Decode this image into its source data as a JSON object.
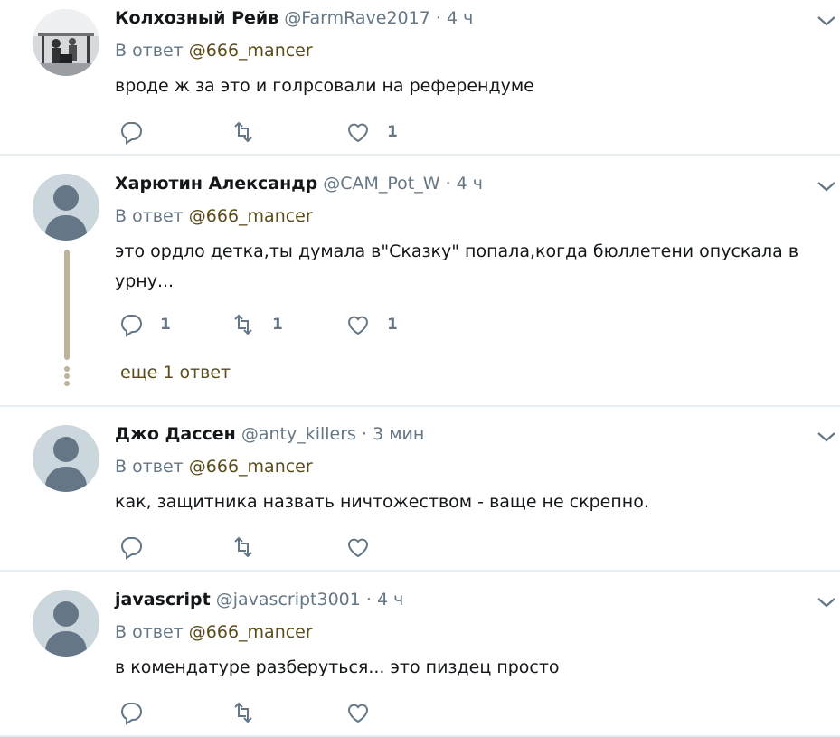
{
  "tweets": [
    {
      "name": "Колхозный Рейв",
      "handle": "@FarmRave2017",
      "time": "· 4 ч",
      "reply_prefix": "В ответ",
      "reply_to": "@666_mancer",
      "text": "вроде ж за это и голрсовали на референдуме",
      "reply_count": "",
      "retweet_count": "",
      "like_count": "1",
      "avatar": "photo"
    },
    {
      "name": "Харютин Александр",
      "handle": "@CAM_Pot_W",
      "time": "· 4 ч",
      "reply_prefix": "В ответ",
      "reply_to": "@666_mancer",
      "text": "это ордло детка,ты думала в\"Сказку\" попала,когда бюллетени опускала в урну...",
      "reply_count": "1",
      "retweet_count": "1",
      "like_count": "1",
      "avatar": "default",
      "more_replies": "еще 1 ответ"
    },
    {
      "name": "Джо Дассен",
      "handle": "@anty_killers",
      "time": "· 3 мин",
      "reply_prefix": "В ответ",
      "reply_to": "@666_mancer",
      "text": "как, защитника назвать ничтожеством - ваще не скрепно.",
      "reply_count": "",
      "retweet_count": "",
      "like_count": "",
      "avatar": "default"
    },
    {
      "name": "javascript",
      "handle": "@javascript3001",
      "time": "· 4 ч",
      "reply_prefix": "В ответ",
      "reply_to": "@666_mancer",
      "text": "в комендатуре разберуться... это пиздец просто",
      "reply_count": "",
      "retweet_count": "",
      "like_count": "",
      "avatar": "default"
    }
  ],
  "icons": {
    "reply": "reply-icon",
    "retweet": "retweet-icon",
    "like": "heart-icon",
    "menu": "chevron-down-icon"
  },
  "colors": {
    "text": "#14171a",
    "secondary": "#657786",
    "mention": "#5c4b1a",
    "thread_line": "#bdb39c",
    "separator": "#e6ecf0"
  }
}
